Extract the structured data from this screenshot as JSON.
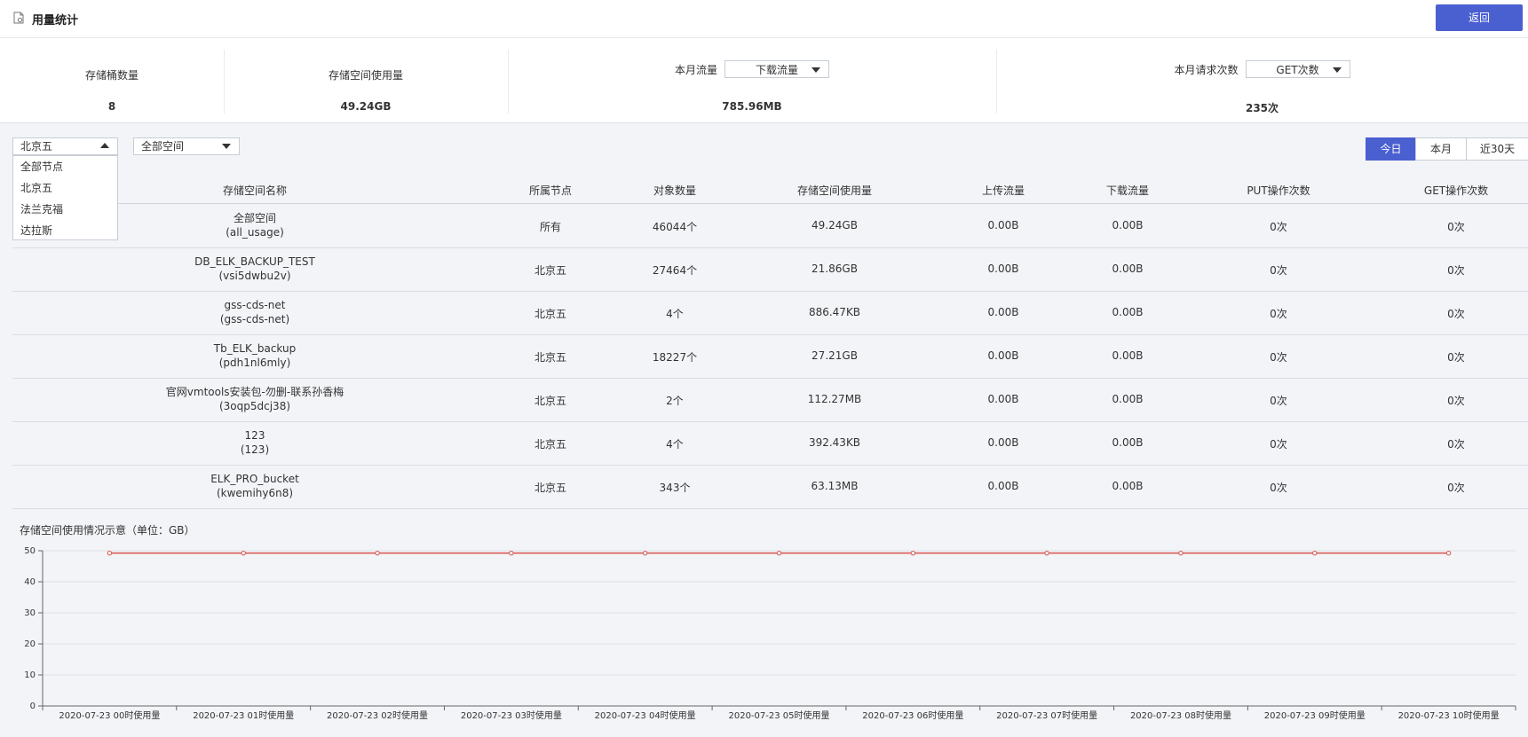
{
  "header": {
    "title": "用量统计",
    "back_label": "返回"
  },
  "stats": {
    "bucket_count": {
      "label": "存储桶数量",
      "value": "8"
    },
    "storage_usage": {
      "label": "存储空间使用量",
      "value": "49.24GB"
    },
    "monthly_traffic": {
      "label": "本月流量",
      "select": "下载流量",
      "value": "785.96MB"
    },
    "monthly_requests": {
      "label": "本月请求次数",
      "select": "GET次数",
      "value": "235次"
    }
  },
  "filters": {
    "node_select": "北京五",
    "space_select": "全部空间",
    "node_options": [
      "全部节点",
      "北京五",
      "法兰克福",
      "达拉斯"
    ]
  },
  "time_tabs": [
    "今日",
    "本月",
    "近30天"
  ],
  "table": {
    "headers": [
      "存储空间名称",
      "所属节点",
      "对象数量",
      "存储空间使用量",
      "上传流量",
      "下载流量",
      "PUT操作次数",
      "GET操作次数"
    ],
    "rows": [
      {
        "name": "全部空间",
        "id": "(all_usage)",
        "node": "所有",
        "objects": "46044个",
        "usage": "49.24GB",
        "upload": "0.00B",
        "download": "0.00B",
        "put": "0次",
        "get": "0次"
      },
      {
        "name": "DB_ELK_BACKUP_TEST",
        "id": "(vsi5dwbu2v)",
        "node": "北京五",
        "objects": "27464个",
        "usage": "21.86GB",
        "upload": "0.00B",
        "download": "0.00B",
        "put": "0次",
        "get": "0次"
      },
      {
        "name": "gss-cds-net",
        "id": "(gss-cds-net)",
        "node": "北京五",
        "objects": "4个",
        "usage": "886.47KB",
        "upload": "0.00B",
        "download": "0.00B",
        "put": "0次",
        "get": "0次"
      },
      {
        "name": "Tb_ELK_backup",
        "id": "(pdh1nl6mly)",
        "node": "北京五",
        "objects": "18227个",
        "usage": "27.21GB",
        "upload": "0.00B",
        "download": "0.00B",
        "put": "0次",
        "get": "0次"
      },
      {
        "name": "官网vmtools安装包-勿删-联系孙香梅",
        "id": "(3oqp5dcj38)",
        "node": "北京五",
        "objects": "2个",
        "usage": "112.27MB",
        "upload": "0.00B",
        "download": "0.00B",
        "put": "0次",
        "get": "0次"
      },
      {
        "name": "123",
        "id": "(123)",
        "node": "北京五",
        "objects": "4个",
        "usage": "392.43KB",
        "upload": "0.00B",
        "download": "0.00B",
        "put": "0次",
        "get": "0次"
      },
      {
        "name": "ELK_PRO_bucket",
        "id": "(kwemihy6n8)",
        "node": "北京五",
        "objects": "343个",
        "usage": "63.13MB",
        "upload": "0.00B",
        "download": "0.00B",
        "put": "0次",
        "get": "0次"
      }
    ]
  },
  "chart_data": {
    "type": "line",
    "title": "存储空间使用情况示意（单位：GB）",
    "categories": [
      "2020-07-23 00时使用量",
      "2020-07-23 01时使用量",
      "2020-07-23 02时使用量",
      "2020-07-23 03时使用量",
      "2020-07-23 04时使用量",
      "2020-07-23 05时使用量",
      "2020-07-23 06时使用量",
      "2020-07-23 07时使用量",
      "2020-07-23 08时使用量",
      "2020-07-23 09时使用量",
      "2020-07-23 10时使用量"
    ],
    "values": [
      49.24,
      49.24,
      49.24,
      49.24,
      49.24,
      49.24,
      49.24,
      49.24,
      49.24,
      49.24,
      49.24
    ],
    "ylim": [
      0,
      50
    ],
    "yticks": [
      0,
      10,
      20,
      30,
      40,
      50
    ],
    "line_color": "#d9534f",
    "grid": true
  },
  "colors": {
    "accent": "#4a5fd0",
    "background": "#f3f4f7"
  }
}
